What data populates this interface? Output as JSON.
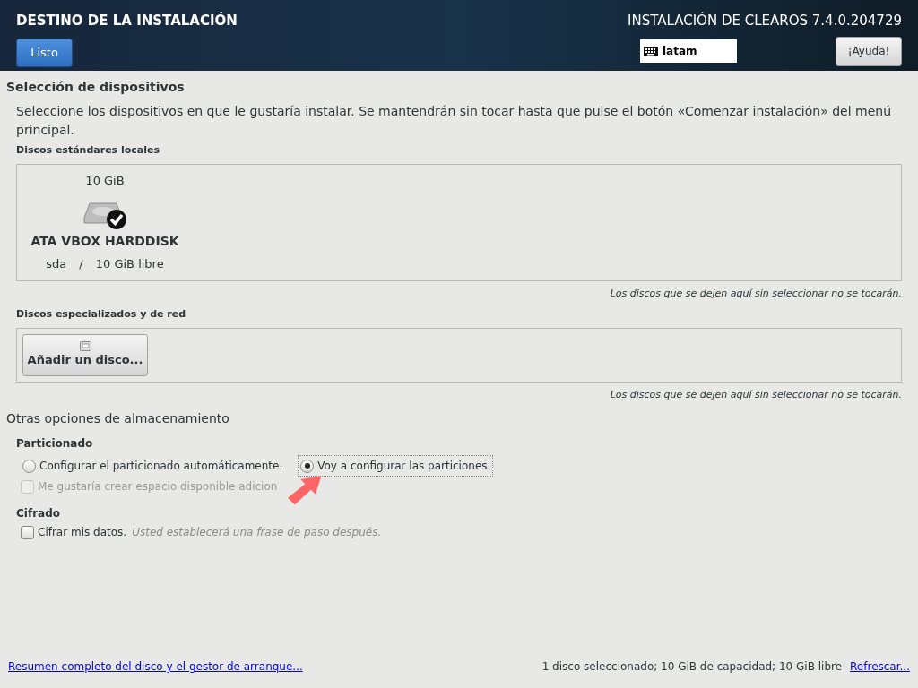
{
  "header": {
    "title": "DESTINO DE LA INSTALACIÓN",
    "done_button": "Listo",
    "product": "INSTALACIÓN DE CLEAROS 7.4.0.204729",
    "keyboard_layout": "latam",
    "help_button": "¡Ayuda!"
  },
  "device_selection": {
    "heading": "Selección de dispositivos",
    "intro": "Seleccione los dispositivos en que le gustaría instalar. Se mantendrán sin tocar hasta que pulse el botón «Comenzar instalación» del menú principal.",
    "local_disks": {
      "label": "Discos estándares locales",
      "disks": [
        {
          "size": "10 GiB",
          "name": "ATA VBOX HARDDISK",
          "device": "sda",
          "separator": "/",
          "free": "10 GiB libre",
          "selected": true
        }
      ],
      "note": "Los discos que se dejen aquí sin seleccionar no se tocarán."
    },
    "special_disks": {
      "label": "Discos especializados y de red",
      "add_button": "Añadir un disco...",
      "note": "Los discos que se dejen aquí sin seleccionar no se tocarán."
    }
  },
  "other_options": {
    "heading": "Otras opciones de almacenamiento",
    "partitioning": {
      "label": "Particionado",
      "options": [
        {
          "label": "Configurar el particionado automáticamente.",
          "selected": false
        },
        {
          "label": "Voy a configurar las particiones.",
          "selected": true
        }
      ],
      "extra_space": {
        "label": "Me gustaría crear espacio disponible adicion",
        "checked": false,
        "disabled": true
      }
    },
    "encryption": {
      "label": "Cifrado",
      "checkbox": {
        "label": "Cifrar mis datos.",
        "hint": "Usted establecerá una frase de paso después.",
        "checked": false,
        "disabled": false
      }
    }
  },
  "footer": {
    "summary_link": "Resumen completo del disco y el gestor de arranque...",
    "status": "1 disco seleccionado; 10 GiB de capacidad; 10 GiB libre",
    "refresh_link": "Refrescar..."
  }
}
